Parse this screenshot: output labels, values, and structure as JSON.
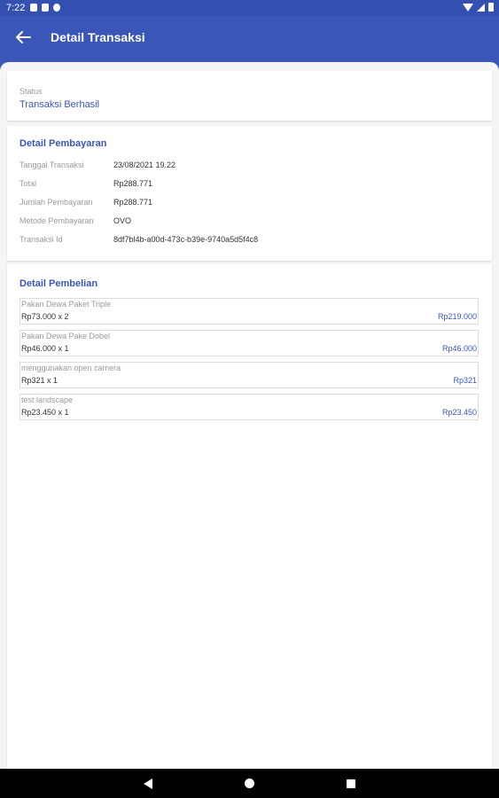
{
  "statusbar": {
    "time": "7:22",
    "icons": [
      "notification-icon",
      "sim-icon",
      "sync-icon"
    ],
    "right_icons": [
      "wifi-icon",
      "signal-icon",
      "battery-icon"
    ]
  },
  "appbar": {
    "title": "Detail Transaksi",
    "back_icon": "arrow-left-icon"
  },
  "status": {
    "label": "Status",
    "value": "Transaksi Berhasil"
  },
  "payment": {
    "title": "Detail Pembayaran",
    "rows": [
      {
        "label": "Tanggal Transaksi",
        "value": "23/08/2021 19.22"
      },
      {
        "label": "Total",
        "value": "Rp288.771"
      },
      {
        "label": "Jumlah Pembayaran",
        "value": "Rp288.771"
      },
      {
        "label": "Metode Pembayaran",
        "value": "OVO"
      },
      {
        "label": "Transaksi Id",
        "value": "8df7bl4b-a00d-473c-b39e-9740a5d5f4c8"
      }
    ]
  },
  "purchase": {
    "title": "Detail Pembelian",
    "items": [
      {
        "name": "Pakan Dewa Paket Triple",
        "qty": "Rp73.000 x 2",
        "subtotal": "Rp219.000"
      },
      {
        "name": "Pakan Dewa Pake Dobel",
        "qty": "Rp46.000 x 1",
        "subtotal": "Rp46.000"
      },
      {
        "name": "menggunakan open camera",
        "qty": "Rp321 x 1",
        "subtotal": "Rp321"
      },
      {
        "name": "test landscape",
        "qty": "Rp23.450 x 1",
        "subtotal": "Rp23.450"
      }
    ]
  },
  "navbar": {
    "icons": [
      "nav-back-icon",
      "nav-home-icon",
      "nav-recents-icon"
    ]
  },
  "colors": {
    "primary": "#3a56b8",
    "background": "#f5f5f5",
    "navbar": "#000000"
  }
}
